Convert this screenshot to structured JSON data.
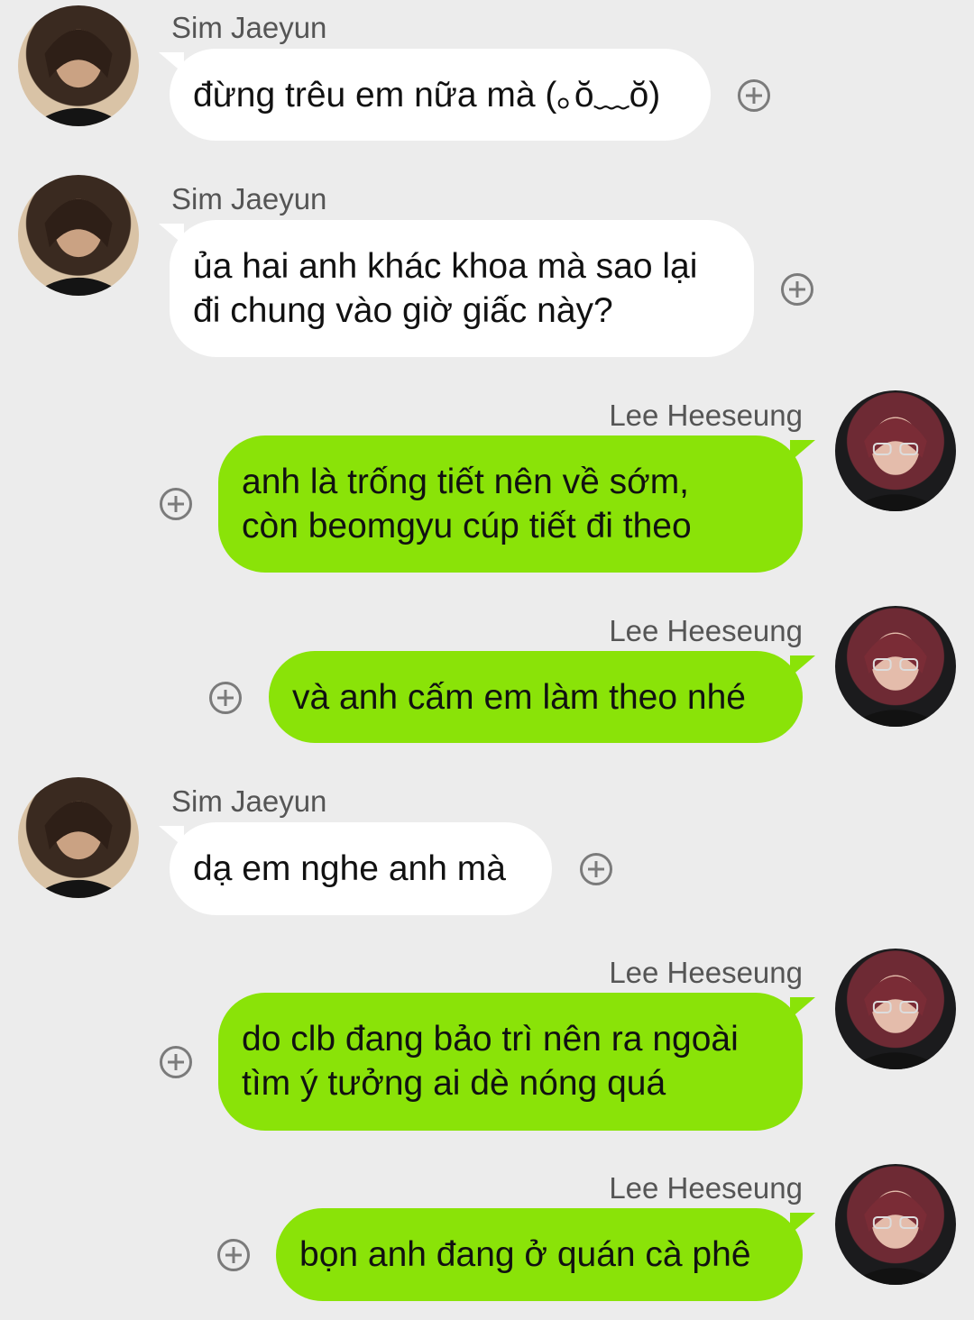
{
  "messages": [
    {
      "sender": "Sim Jaeyun",
      "side": "left",
      "text": "đừng trêu em nữa mà (｡ŏ﹏ŏ)"
    },
    {
      "sender": "Sim Jaeyun",
      "side": "left",
      "text": "ủa hai anh khác khoa mà sao lại\nđi chung vào giờ giấc này?"
    },
    {
      "sender": "Lee Heeseung",
      "side": "right",
      "text": "anh là trống tiết nên về sớm,\ncòn beomgyu cúp tiết đi theo"
    },
    {
      "sender": "Lee Heeseung",
      "side": "right",
      "text": "và anh cấm em làm theo nhé"
    },
    {
      "sender": "Sim Jaeyun",
      "side": "left",
      "text": "dạ em nghe anh mà"
    },
    {
      "sender": "Lee Heeseung",
      "side": "right",
      "text": "do clb đang bảo trì nên ra ngoài\ntìm ý tưởng ai dè nóng quá"
    },
    {
      "sender": "Lee Heeseung",
      "side": "right",
      "text": "bọn anh đang ở quán cà phê"
    }
  ],
  "colors": {
    "background": "#ececec",
    "incoming_bubble": "#ffffff",
    "outgoing_bubble": "#8ae308"
  },
  "icons": {
    "add_reaction": "plus-circle-icon"
  }
}
